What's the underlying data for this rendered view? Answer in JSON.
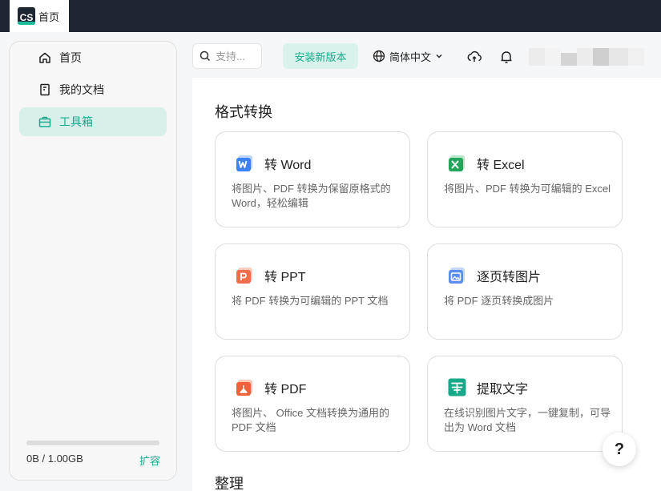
{
  "titlebar": {
    "logo_text": "CS",
    "tab_label": "首页"
  },
  "sidebar": {
    "items": [
      {
        "label": "首页",
        "icon": "home-icon",
        "active": false
      },
      {
        "label": "我的文档",
        "icon": "document-icon",
        "active": false
      },
      {
        "label": "工具箱",
        "icon": "toolbox-icon",
        "active": true
      }
    ],
    "storage": {
      "used_text": "0B / 1.00GB",
      "fraction": 0.0,
      "expand_label": "扩容"
    }
  },
  "toolbar": {
    "search_placeholder": "支持...",
    "install_label": "安装新版本",
    "language_label": "简体中文",
    "icons": [
      "globe-icon",
      "chevron-down-icon",
      "cloud-sync-icon",
      "bell-icon"
    ]
  },
  "main": {
    "section_format": "格式转换",
    "section_organize": "整理",
    "cards": [
      {
        "title": "转 Word",
        "desc": "将图片、PDF 转换为保留原格式的 Word，轻松编辑",
        "icon": "word-icon"
      },
      {
        "title": "转 Excel",
        "desc": "将图片、PDF 转换为可编辑的 Excel",
        "icon": "excel-icon"
      },
      {
        "title": "转 PPT",
        "desc": "将 PDF 转换为可编辑的 PPT 文档",
        "icon": "ppt-icon"
      },
      {
        "title": "逐页转图片",
        "desc": "将 PDF 逐页转换成图片",
        "icon": "image-icon"
      },
      {
        "title": "转 PDF",
        "desc": "将图片、 Office 文档转换为通用的 PDF 文档",
        "icon": "pdf-icon"
      },
      {
        "title": "提取文字",
        "desc": "在线识别图片文字，一键复制，可导出为 Word 文档",
        "icon": "text-extract-icon"
      }
    ]
  },
  "help": {
    "label": "?"
  },
  "colors": {
    "accent": "#19bc9c",
    "accent_text": "#19a98b",
    "titlebar": "#1f2633",
    "word": "#3b82f6",
    "excel": "#22a55a",
    "ppt": "#f06e4b",
    "image": "#5b8def",
    "pdf": "#f0603a",
    "text_extract": "#1aa88a"
  }
}
